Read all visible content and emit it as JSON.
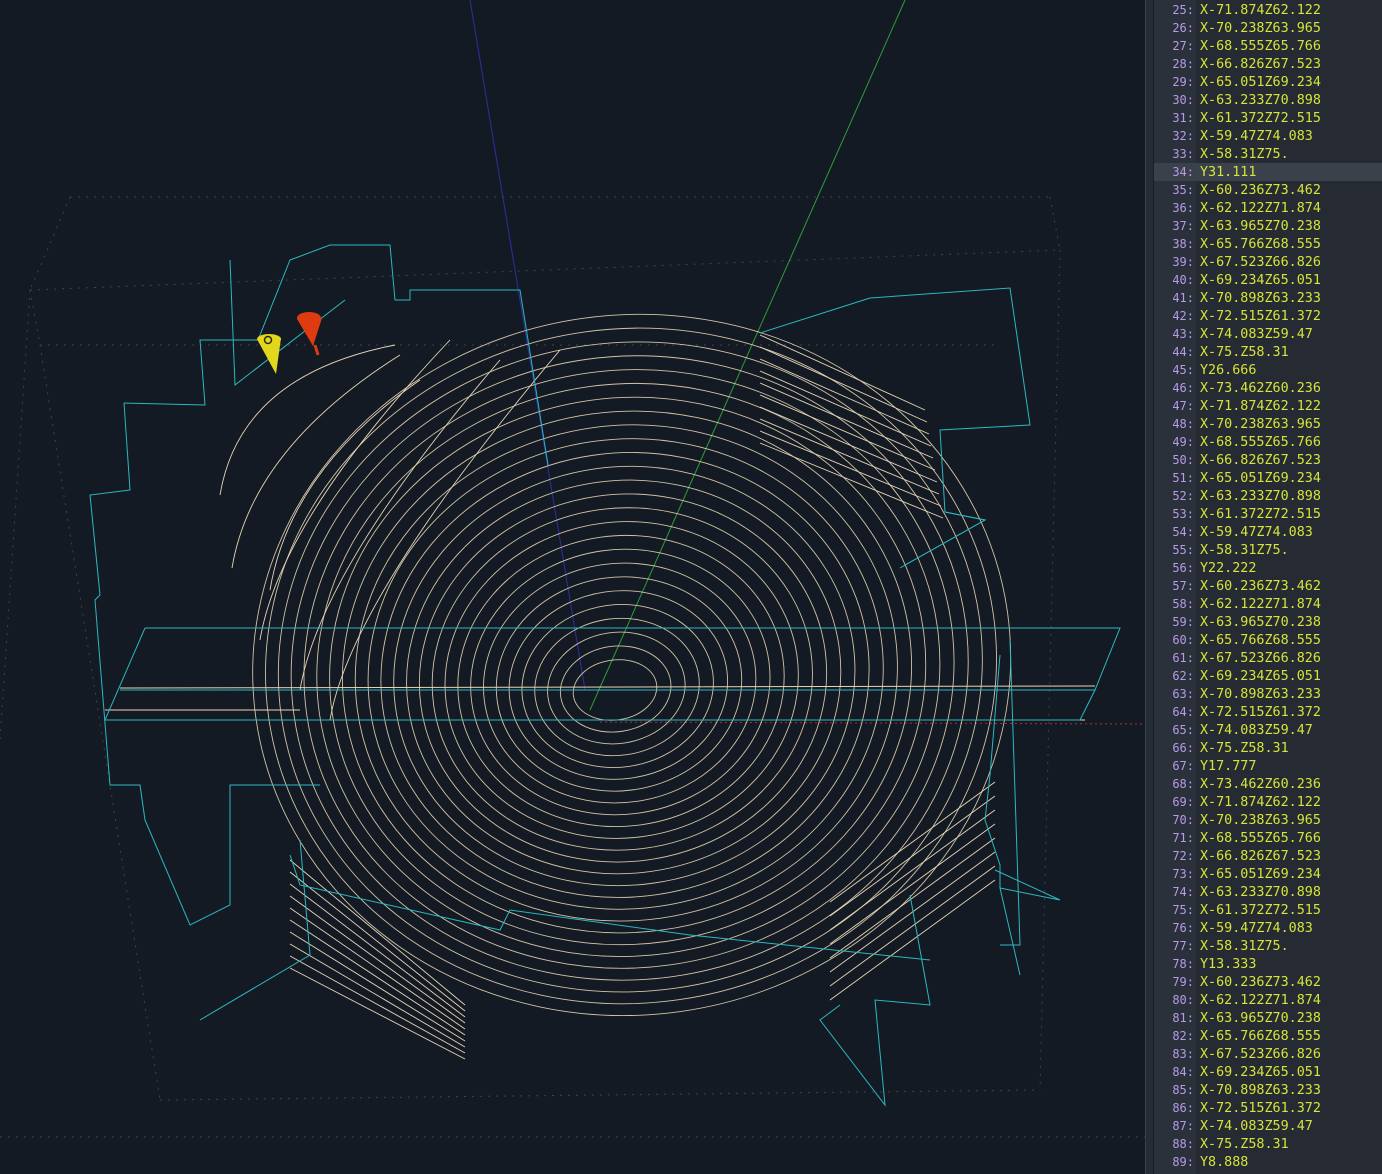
{
  "viewport": {
    "colors": {
      "background": "#141a24",
      "toolpath": "#e6d6b4",
      "rapid": "#2bb8bf",
      "axis_x": "#b8262f",
      "axis_y": "#2e9d3a",
      "axis_z": "#2c2f9e",
      "bounds": "#3c4450",
      "tool_current": "#e03a10",
      "tool_ghost": "#e2d71c"
    }
  },
  "editor": {
    "current_line": 34,
    "lines": [
      {
        "n": "25:",
        "code": "X-71.874Z62.122"
      },
      {
        "n": "26:",
        "code": "X-70.238Z63.965"
      },
      {
        "n": "27:",
        "code": "X-68.555Z65.766"
      },
      {
        "n": "28:",
        "code": "X-66.826Z67.523"
      },
      {
        "n": "29:",
        "code": "X-65.051Z69.234"
      },
      {
        "n": "30:",
        "code": "X-63.233Z70.898"
      },
      {
        "n": "31:",
        "code": "X-61.372Z72.515"
      },
      {
        "n": "32:",
        "code": "X-59.47Z74.083"
      },
      {
        "n": "33:",
        "code": "X-58.31Z75."
      },
      {
        "n": "34:",
        "code": "Y31.111"
      },
      {
        "n": "35:",
        "code": "X-60.236Z73.462"
      },
      {
        "n": "36:",
        "code": "X-62.122Z71.874"
      },
      {
        "n": "37:",
        "code": "X-63.965Z70.238"
      },
      {
        "n": "38:",
        "code": "X-65.766Z68.555"
      },
      {
        "n": "39:",
        "code": "X-67.523Z66.826"
      },
      {
        "n": "40:",
        "code": "X-69.234Z65.051"
      },
      {
        "n": "41:",
        "code": "X-70.898Z63.233"
      },
      {
        "n": "42:",
        "code": "X-72.515Z61.372"
      },
      {
        "n": "43:",
        "code": "X-74.083Z59.47"
      },
      {
        "n": "44:",
        "code": "X-75.Z58.31"
      },
      {
        "n": "45:",
        "code": "Y26.666"
      },
      {
        "n": "46:",
        "code": "X-73.462Z60.236"
      },
      {
        "n": "47:",
        "code": "X-71.874Z62.122"
      },
      {
        "n": "48:",
        "code": "X-70.238Z63.965"
      },
      {
        "n": "49:",
        "code": "X-68.555Z65.766"
      },
      {
        "n": "50:",
        "code": "X-66.826Z67.523"
      },
      {
        "n": "51:",
        "code": "X-65.051Z69.234"
      },
      {
        "n": "52:",
        "code": "X-63.233Z70.898"
      },
      {
        "n": "53:",
        "code": "X-61.372Z72.515"
      },
      {
        "n": "54:",
        "code": "X-59.47Z74.083"
      },
      {
        "n": "55:",
        "code": "X-58.31Z75."
      },
      {
        "n": "56:",
        "code": "Y22.222"
      },
      {
        "n": "57:",
        "code": "X-60.236Z73.462"
      },
      {
        "n": "58:",
        "code": "X-62.122Z71.874"
      },
      {
        "n": "59:",
        "code": "X-63.965Z70.238"
      },
      {
        "n": "60:",
        "code": "X-65.766Z68.555"
      },
      {
        "n": "61:",
        "code": "X-67.523Z66.826"
      },
      {
        "n": "62:",
        "code": "X-69.234Z65.051"
      },
      {
        "n": "63:",
        "code": "X-70.898Z63.233"
      },
      {
        "n": "64:",
        "code": "X-72.515Z61.372"
      },
      {
        "n": "65:",
        "code": "X-74.083Z59.47"
      },
      {
        "n": "66:",
        "code": "X-75.Z58.31"
      },
      {
        "n": "67:",
        "code": "Y17.777"
      },
      {
        "n": "68:",
        "code": "X-73.462Z60.236"
      },
      {
        "n": "69:",
        "code": "X-71.874Z62.122"
      },
      {
        "n": "70:",
        "code": "X-70.238Z63.965"
      },
      {
        "n": "71:",
        "code": "X-68.555Z65.766"
      },
      {
        "n": "72:",
        "code": "X-66.826Z67.523"
      },
      {
        "n": "73:",
        "code": "X-65.051Z69.234"
      },
      {
        "n": "74:",
        "code": "X-63.233Z70.898"
      },
      {
        "n": "75:",
        "code": "X-61.372Z72.515"
      },
      {
        "n": "76:",
        "code": "X-59.47Z74.083"
      },
      {
        "n": "77:",
        "code": "X-58.31Z75."
      },
      {
        "n": "78:",
        "code": "Y13.333"
      },
      {
        "n": "79:",
        "code": "X-60.236Z73.462"
      },
      {
        "n": "80:",
        "code": "X-62.122Z71.874"
      },
      {
        "n": "81:",
        "code": "X-63.965Z70.238"
      },
      {
        "n": "82:",
        "code": "X-65.766Z68.555"
      },
      {
        "n": "83:",
        "code": "X-67.523Z66.826"
      },
      {
        "n": "84:",
        "code": "X-69.234Z65.051"
      },
      {
        "n": "85:",
        "code": "X-70.898Z63.233"
      },
      {
        "n": "86:",
        "code": "X-72.515Z61.372"
      },
      {
        "n": "87:",
        "code": "X-74.083Z59.47"
      },
      {
        "n": "88:",
        "code": "X-75.Z58.31"
      },
      {
        "n": "89:",
        "code": "Y8.888"
      }
    ]
  }
}
